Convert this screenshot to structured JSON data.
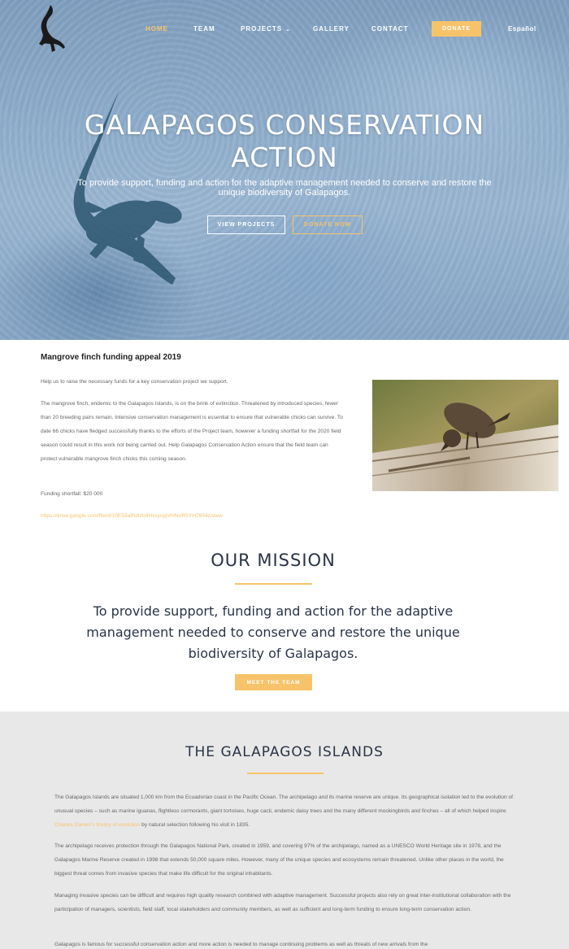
{
  "nav": {
    "items": [
      {
        "label": "HOME",
        "active": true
      },
      {
        "label": "TEAM"
      },
      {
        "label": "PROJECTS",
        "has_caret": true
      },
      {
        "label": "GALLERY"
      },
      {
        "label": "CONTACT"
      }
    ],
    "donate_label": "DONATE",
    "language_label": "Español"
  },
  "hero": {
    "title_line1": "GALAPAGOS CONSERVATION",
    "title_line2": "ACTION",
    "subtitle": "To provide support, funding and action for the adaptive management needed to conserve and restore the unique biodiversity of Galapagos.",
    "view_projects_label": "VIEW PROJECTS",
    "donate_now_label": "DONATE NOW"
  },
  "appeal": {
    "title": "Mangrove finch funding appeal 2019",
    "intro": "Help us to raise the necessary funds for a key conservation project we support.",
    "body": "The mangrove finch, endemic to the Galapagos Islands, is on the brink of extinction. Threatened by introduced species, fewer than 20 breeding pairs remain. Intensive conservation management is essential to ensure that vulnerable chicks can survive. To date 66 chicks have fledged successfully thanks to the efforts of the Project team, however a funding shortfall for the 2020 field season could result in this work not being carried out. Help Galapagos Conservation Action ensure that the field team can protect vulnerable mangrove finch chicks this coming season.",
    "shortfall": "Funding shortfall: $20 000",
    "link": "https://drive.google.com/file/d/10E53aPoll2o9HxsyopjVHNoR5YH7654z/view"
  },
  "mission": {
    "heading": "OUR MISSION",
    "text": "To provide support, funding and action for the adaptive management needed to conserve and restore the unique biodiversity of Galapagos.",
    "button_label": "MEET THE TEAM"
  },
  "islands": {
    "heading": "THE GALAPAGOS ISLANDS",
    "p1_before": "The Galapagos Islands are situated 1,000 km from the Ecuadorian coast in the Pacific Ocean. The archipelago and its marine reserve are unique. Its geographical isolation led to the evolution of unusual species – such as marine iguanas, flightless cormorants, giant tortoises, huge cacti, endemic daisy trees and the many different mockingbirds and finches – all of which helped inspire ",
    "p1_link": "Charles Darwin's theory of evolution",
    "p1_after": " by natural selection following his visit in 1835.",
    "p2": "The archipelago receives protection through the Galapagos National Park, created in 1959, and covering 97% of the archipelago, named as a UNESCO World Heritage site in 1978, and the Galapagos Marine Reserve created in 1998 that extends 50,000 square miles. However, many of the unique species and ecosystems remain threatened. Unlike other places in the world, the biggest threat comes from invasive species that make life difficult for the original inhabitants.",
    "p3": "Managing invasive species can be difficult and requires high quality research combined with adaptive management. Successful projects also rely on great inter-institutional collaboration with the participation of managers, scientists, field staff, local stakeholders and community members, as well as sufficient and long-term funding to ensure long-term conservation action.",
    "p4": "Galapagos is famous for successful conservation action and more action is needed to manage continuing problems as well as threats of new arrivals from the"
  },
  "colors": {
    "accent": "#f7c36a",
    "heading": "#2a3446",
    "islands_bg": "#e8e8e8"
  }
}
